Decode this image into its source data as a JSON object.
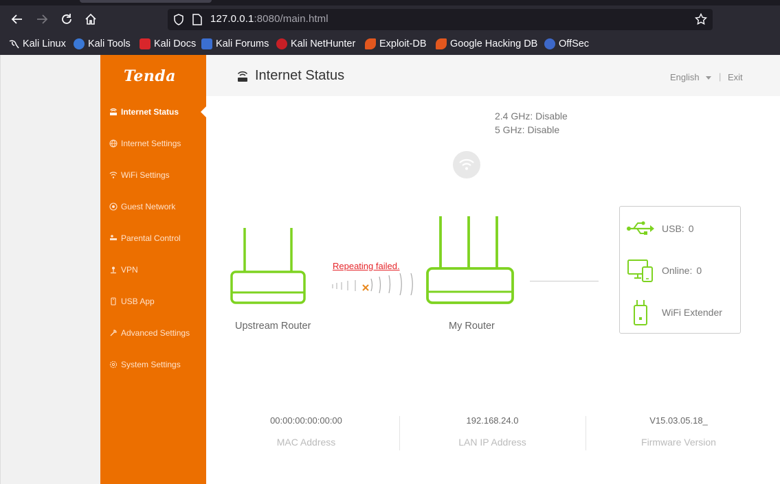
{
  "browser": {
    "url_host": "127.0.0.1",
    "url_rest": ":8080/main.html",
    "bookmarks": [
      {
        "label": "Kali Linux",
        "icon": "kali-dragon-icon"
      },
      {
        "label": "Kali Tools",
        "icon": "kali-tools-icon"
      },
      {
        "label": "Kali Docs",
        "icon": "kali-docs-icon"
      },
      {
        "label": "Kali Forums",
        "icon": "kali-forums-icon"
      },
      {
        "label": "Kali NetHunter",
        "icon": "nethunter-icon"
      },
      {
        "label": "Exploit-DB",
        "icon": "exploit-db-icon"
      },
      {
        "label": "Google Hacking DB",
        "icon": "ghdb-icon"
      },
      {
        "label": "OffSec",
        "icon": "offsec-icon"
      }
    ]
  },
  "sidebar": {
    "logo": "Tenda",
    "items": [
      {
        "label": "Internet Status",
        "icon": "router-icon",
        "active": true
      },
      {
        "label": "Internet Settings",
        "icon": "globe-icon"
      },
      {
        "label": "WiFi Settings",
        "icon": "wifi-icon"
      },
      {
        "label": "Guest Network",
        "icon": "guest-wifi-icon"
      },
      {
        "label": "Parental Control",
        "icon": "parental-icon"
      },
      {
        "label": "VPN",
        "icon": "vpn-icon"
      },
      {
        "label": "USB App",
        "icon": "usb-drive-icon"
      },
      {
        "label": "Advanced Settings",
        "icon": "wrench-icon"
      },
      {
        "label": "System Settings",
        "icon": "gear-icon"
      }
    ]
  },
  "header": {
    "title": "Internet Status",
    "language": "English",
    "separator": "|",
    "exit": "Exit"
  },
  "wifi": {
    "band_24": "2.4 GHz: Disable",
    "band_5": "5 GHz: Disable"
  },
  "diagram": {
    "upstream_label": "Upstream Router",
    "my_router_label": "My Router",
    "repeat_status": "Repeating failed.",
    "usb_label": "USB:",
    "usb_count": "0",
    "online_label": "Online:",
    "online_count": "0",
    "extender_label": "WiFi Extender"
  },
  "info": {
    "mac_value": "00:00:00:00:00:00",
    "mac_label": "MAC Address",
    "lan_value": "192.168.24.0",
    "lan_label": "LAN IP Address",
    "fw_value": "V15.03.05.18_",
    "fw_label": "Firmware Version"
  },
  "colors": {
    "brand_orange": "#ec6f00",
    "device_green": "#7ed321",
    "error_red": "#e5252a"
  }
}
